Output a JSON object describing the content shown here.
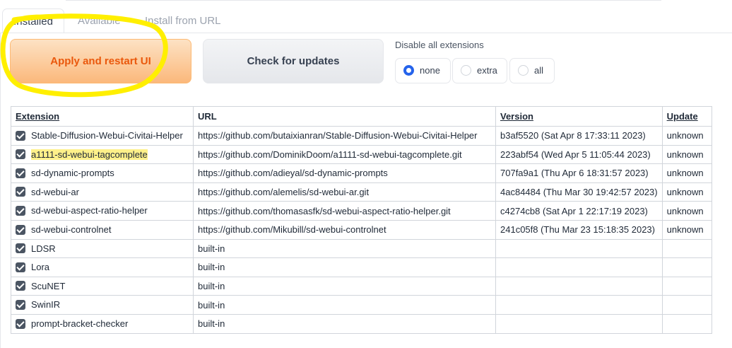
{
  "tabs": [
    {
      "label": "Installed",
      "active": true
    },
    {
      "label": "Available",
      "active": false
    },
    {
      "label": "Install from URL",
      "active": false
    }
  ],
  "buttons": {
    "apply_label": "Apply and restart UI",
    "check_label": "Check for updates"
  },
  "disable_all": {
    "title": "Disable all extensions",
    "options": [
      "none",
      "extra",
      "all"
    ],
    "selected": "none"
  },
  "table": {
    "headers": [
      "Extension",
      "URL",
      "Version",
      "Update"
    ],
    "rows": [
      {
        "name": "Stable-Diffusion-Webui-Civitai-Helper",
        "url": "https://github.com/butaixianran/Stable-Diffusion-Webui-Civitai-Helper",
        "version": "b3af5520 (Sat Apr 8 17:33:11 2023)",
        "update": "unknown",
        "checked": true
      },
      {
        "name": "a1111-sd-webui-tagcomplete",
        "url": "https://github.com/DominikDoom/a1111-sd-webui-tagcomplete.git",
        "version": "223abf54 (Wed Apr 5 11:05:44 2023)",
        "update": "unknown",
        "checked": true,
        "highlighted": true
      },
      {
        "name": "sd-dynamic-prompts",
        "url": "https://github.com/adieyal/sd-dynamic-prompts",
        "version": "707fa9a1 (Thu Apr 6 18:31:57 2023)",
        "update": "unknown",
        "checked": true
      },
      {
        "name": "sd-webui-ar",
        "url": "https://github.com/alemelis/sd-webui-ar.git",
        "version": "4ac84484 (Thu Mar 30 19:42:57 2023)",
        "update": "unknown",
        "checked": true
      },
      {
        "name": "sd-webui-aspect-ratio-helper",
        "url": "https://github.com/thomasasfk/sd-webui-aspect-ratio-helper.git",
        "version": "c4274cb8 (Sat Apr 1 22:17:19 2023)",
        "update": "unknown",
        "checked": true
      },
      {
        "name": "sd-webui-controlnet",
        "url": "https://github.com/Mikubill/sd-webui-controlnet",
        "version": "241c05f8 (Thu Mar 23 15:18:35 2023)",
        "update": "unknown",
        "checked": true
      },
      {
        "name": "LDSR",
        "url": "built-in",
        "version": "",
        "update": "",
        "checked": true
      },
      {
        "name": "Lora",
        "url": "built-in",
        "version": "",
        "update": "",
        "checked": true
      },
      {
        "name": "ScuNET",
        "url": "built-in",
        "version": "",
        "update": "",
        "checked": true
      },
      {
        "name": "SwinIR",
        "url": "built-in",
        "version": "",
        "update": "",
        "checked": true
      },
      {
        "name": "prompt-bracket-checker",
        "url": "built-in",
        "version": "",
        "update": "",
        "checked": true
      }
    ]
  },
  "colors": {
    "apply_text": "#ea580c",
    "apply_bg": "#fbb87b",
    "radio_selected": "#2563eb",
    "highlighter": "#fef08a",
    "annotation_ring": "#ffef00"
  }
}
